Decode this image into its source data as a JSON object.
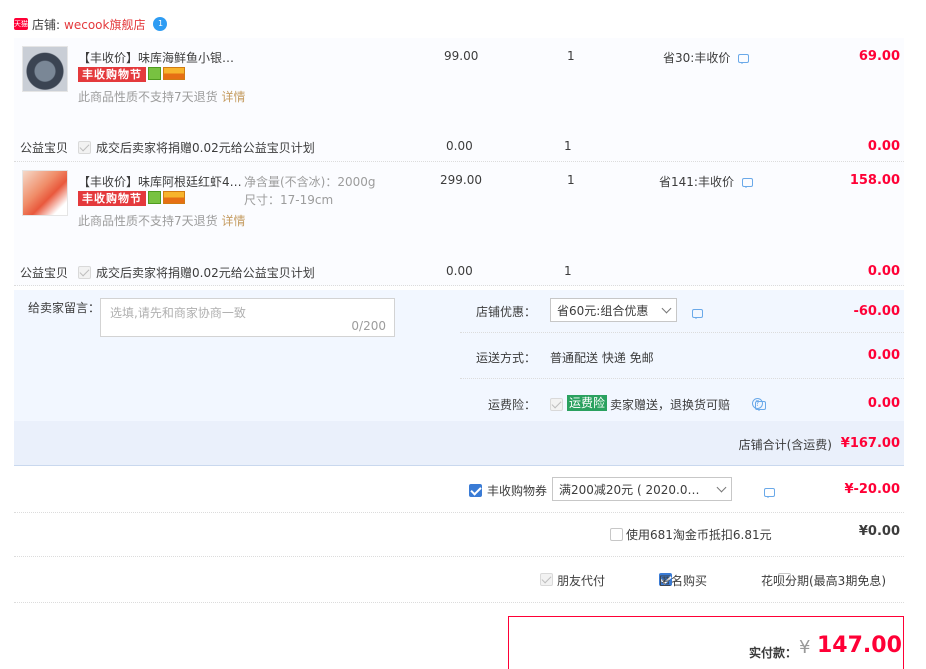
{
  "store": {
    "tmall_label": "天猫",
    "label": "店铺:",
    "name": "wecook旗舰店",
    "chat_badge": "1"
  },
  "items": [
    {
      "title": "【丰收价】味库海鲜鱼小银…",
      "spec_line1": "",
      "spec_line2": "",
      "promo": "丰收购物节",
      "policy": "此商品性质不支持7天退货",
      "policy_link": "详情",
      "price": "99.00",
      "qty": "1",
      "discount": "省30:丰收价",
      "subtotal": "69.00",
      "charity_label": "公益宝贝",
      "charity_text": "成交后卖家将捐赠0.02元给公益宝贝计划",
      "charity_price": "0.00",
      "charity_qty": "1",
      "charity_subtotal": "0.00"
    },
    {
      "title": "【丰收价】味库阿根廷红虾4…",
      "spec_line1": "净含量(不含冰)：2000g",
      "spec_line2": "尺寸：17-19cm",
      "promo": "丰收购物节",
      "policy": "此商品性质不支持7天退货",
      "policy_link": "详情",
      "price": "299.00",
      "qty": "1",
      "discount": "省141:丰收价",
      "subtotal": "158.00",
      "charity_label": "公益宝贝",
      "charity_text": "成交后卖家将捐赠0.02元给公益宝贝计划",
      "charity_price": "0.00",
      "charity_qty": "1",
      "charity_subtotal": "0.00"
    }
  ],
  "message": {
    "label": "给卖家留言：",
    "placeholder": "选填,请先和商家协商一致",
    "counter": "0/200"
  },
  "store_discount": {
    "label": "店铺优惠：",
    "selected": "省60元:组合优惠",
    "amount": "-60.00"
  },
  "shipping": {
    "label": "运送方式：",
    "value": "普通配送 快递 免邮",
    "amount": "0.00"
  },
  "insurance": {
    "label": "运费险：",
    "badge": "运费险",
    "text": "卖家赠送，退换货可赔",
    "amount": "0.00"
  },
  "store_total": {
    "label": "店铺合计(含运费)",
    "amount": "¥167.00"
  },
  "coupon": {
    "label": "丰收购物券",
    "selected": "满200减20元 ( 2020.0…",
    "amount": "¥-20.00"
  },
  "taobao_coin": {
    "label": "使用681淘金币抵扣6.81元",
    "amount": "¥0.00"
  },
  "options": {
    "friend_pay": "朋友代付",
    "anonymous": "匿名购买",
    "huabei": "花呗分期(最高3期免息)"
  },
  "payment": {
    "label": "实付款：",
    "currency": "¥",
    "amount": "147.00"
  },
  "colors": {
    "accent_red": "#ff0036",
    "panel_blue": "#f2f7ff",
    "total_bar": "#eaf0fb"
  }
}
